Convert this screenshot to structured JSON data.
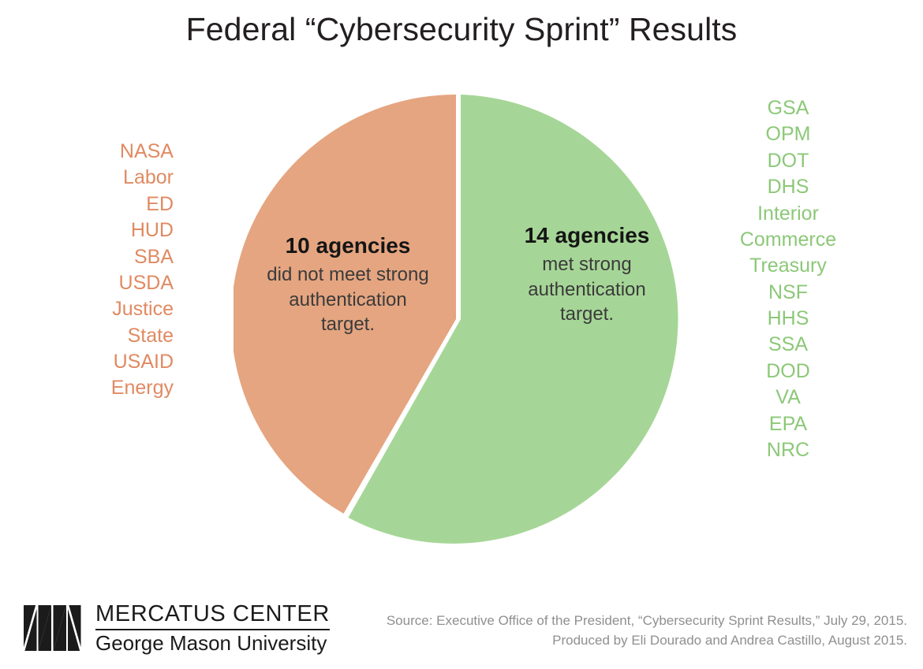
{
  "title": "Federal “Cybersecurity Sprint” Results",
  "colors": {
    "slice_not_met_fill": "#E5A580",
    "slice_met_fill": "#A6D697",
    "list_not_met_text": "#E08A62",
    "list_met_text": "#8CC878",
    "background": "#FFFFFF",
    "title_text": "#231F20",
    "source_text": "#8F8F8F",
    "logo": "#1B1B1B"
  },
  "slice_labels": {
    "not_met": {
      "headline": "10 agencies",
      "line1": "did not meet strong",
      "line2": "authentication",
      "line3": "target."
    },
    "met": {
      "headline": "14 agencies",
      "line1": "met strong",
      "line2": "authentication",
      "line3": "target."
    }
  },
  "lists": {
    "not_met": [
      "NASA",
      "Labor",
      "ED",
      "HUD",
      "SBA",
      "USDA",
      "Justice",
      "State",
      "USAID",
      "Energy"
    ],
    "met": [
      "GSA",
      "OPM",
      "DOT",
      "DHS",
      "Interior",
      "Commerce",
      "Treasury",
      "NSF",
      "HHS",
      "SSA",
      "DOD",
      "VA",
      "EPA",
      "NRC"
    ]
  },
  "logo": {
    "mark": "mercatus-angular-m-mark",
    "primary": "MERCATUS CENTER",
    "secondary": "George Mason University"
  },
  "source": {
    "line1": "Source: Executive Office of the President, “Cybersecurity Sprint Results,” July 29, 2015.",
    "line2": "Produced by Eli Dourado and Andrea Castillo, August 2015."
  },
  "chart_data": {
    "type": "pie",
    "title": "Federal “Cybersecurity Sprint” Results",
    "xlabel": "",
    "ylabel": "",
    "total": 24,
    "units": "agencies",
    "start_angle_deg": 0,
    "direction": "counterclockwise-for-first-slice",
    "legend": "labels placed inside slices; agency names listed beside each slice",
    "grid": false,
    "categories": [
      "10 agencies did not meet strong authentication target.",
      "14 agencies met strong authentication target."
    ],
    "values": [
      10,
      14
    ],
    "percentages": [
      41.7,
      58.3
    ],
    "slices": [
      {
        "name": "Did not meet strong authentication target",
        "value": 10,
        "percent": 41.7,
        "angle_deg": 150,
        "color": "#E5A580",
        "agencies": [
          "NASA",
          "Labor",
          "ED",
          "HUD",
          "SBA",
          "USDA",
          "Justice",
          "State",
          "USAID",
          "Energy"
        ]
      },
      {
        "name": "Met strong authentication target",
        "value": 14,
        "percent": 58.3,
        "angle_deg": 210,
        "color": "#A6D697",
        "agencies": [
          "GSA",
          "OPM",
          "DOT",
          "DHS",
          "Interior",
          "Commerce",
          "Treasury",
          "NSF",
          "HHS",
          "SSA",
          "DOD",
          "VA",
          "EPA",
          "NRC"
        ]
      }
    ]
  }
}
